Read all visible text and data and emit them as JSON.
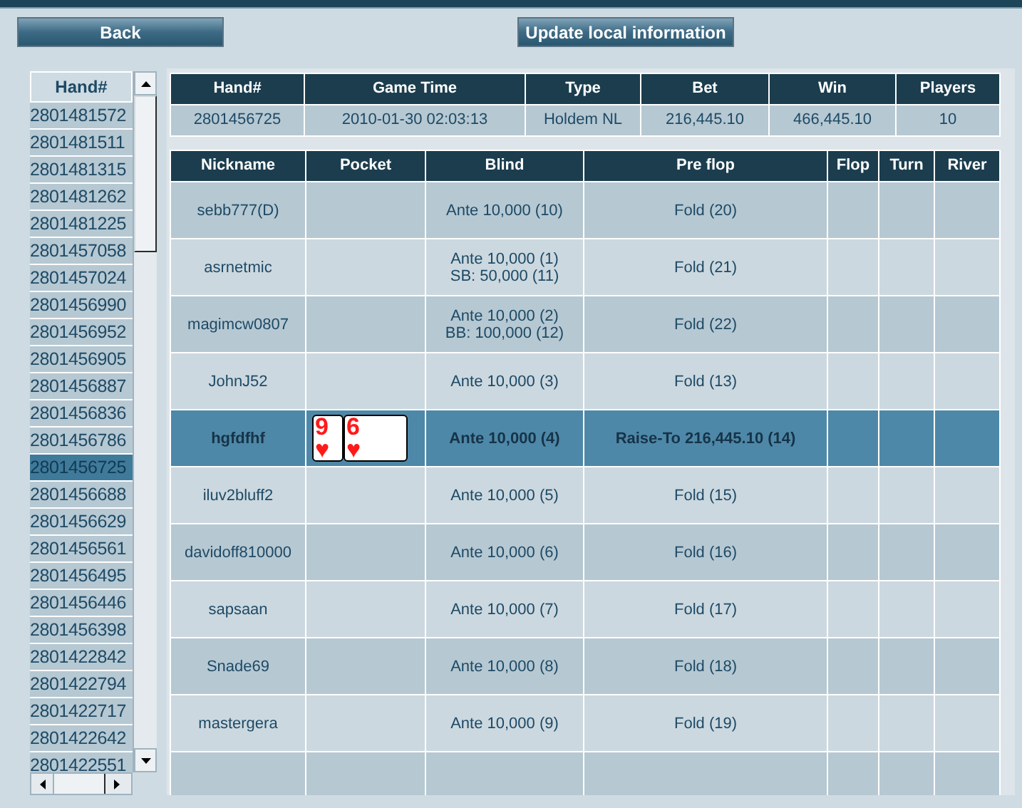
{
  "toolbar": {
    "back": "Back",
    "update": "Update local information"
  },
  "hand_list": {
    "header": "Hand#",
    "items": [
      {
        "label": "2801481572",
        "selected": false
      },
      {
        "label": "2801481511",
        "selected": false
      },
      {
        "label": "2801481315",
        "selected": false
      },
      {
        "label": "2801481262",
        "selected": false
      },
      {
        "label": "2801481225",
        "selected": false
      },
      {
        "label": "2801457058",
        "selected": false
      },
      {
        "label": "2801457024",
        "selected": false
      },
      {
        "label": "2801456990",
        "selected": false
      },
      {
        "label": "2801456952",
        "selected": false
      },
      {
        "label": "2801456905",
        "selected": false
      },
      {
        "label": "2801456887",
        "selected": false
      },
      {
        "label": "2801456836",
        "selected": false
      },
      {
        "label": "2801456786",
        "selected": false
      },
      {
        "label": "2801456725",
        "selected": true
      },
      {
        "label": "2801456688",
        "selected": false
      },
      {
        "label": "2801456629",
        "selected": false
      },
      {
        "label": "2801456561",
        "selected": false
      },
      {
        "label": "2801456495",
        "selected": false
      },
      {
        "label": "2801456446",
        "selected": false
      },
      {
        "label": "2801456398",
        "selected": false
      },
      {
        "label": "2801422842",
        "selected": false
      },
      {
        "label": "2801422794",
        "selected": false
      },
      {
        "label": "2801422717",
        "selected": false
      },
      {
        "label": "2801422642",
        "selected": false
      },
      {
        "label": "2801422551",
        "selected": false
      }
    ]
  },
  "hand_info": {
    "columns": [
      "Hand#",
      "Game Time",
      "Type",
      "Bet",
      "Win",
      "Players"
    ],
    "row": [
      "2801456725",
      "2010-01-30 02:03:13",
      "Holdem NL",
      "216,445.10",
      "466,445.10",
      "10"
    ]
  },
  "players": {
    "columns": [
      "Nickname",
      "Pocket",
      "Blind",
      "Pre flop",
      "Flop",
      "Turn",
      "River"
    ],
    "rows": [
      {
        "nickname": "sebb777(D)",
        "blind": [
          "Ante 10,000 (10)"
        ],
        "pre_flop": "Fold (20)",
        "selected": false
      },
      {
        "nickname": "asrnetmic",
        "blind": [
          "Ante 10,000 (1)",
          "SB: 50,000 (11)"
        ],
        "pre_flop": "Fold (21)",
        "selected": false
      },
      {
        "nickname": "magimcw0807",
        "blind": [
          "Ante 10,000 (2)",
          "BB: 100,000 (12)"
        ],
        "pre_flop": "Fold (22)",
        "selected": false
      },
      {
        "nickname": "JohnJ52",
        "blind": [
          "Ante 10,000 (3)"
        ],
        "pre_flop": "Fold (13)",
        "selected": false
      },
      {
        "nickname": "hgfdfhf",
        "pocket": [
          {
            "rank": "9",
            "suit": "♥"
          },
          {
            "rank": "6",
            "suit": "♥"
          }
        ],
        "blind": [
          "Ante 10,000 (4)"
        ],
        "pre_flop": "Raise-To 216,445.10 (14)",
        "selected": true
      },
      {
        "nickname": "iluv2bluff2",
        "blind": [
          "Ante 10,000 (5)"
        ],
        "pre_flop": "Fold (15)",
        "selected": false
      },
      {
        "nickname": "davidoff810000",
        "blind": [
          "Ante 10,000 (6)"
        ],
        "pre_flop": "Fold (16)",
        "selected": false
      },
      {
        "nickname": "sapsaan",
        "blind": [
          "Ante 10,000 (7)"
        ],
        "pre_flop": "Fold (17)",
        "selected": false
      },
      {
        "nickname": "Snade69",
        "blind": [
          "Ante 10,000 (8)"
        ],
        "pre_flop": "Fold (18)",
        "selected": false
      },
      {
        "nickname": "mastergera",
        "blind": [
          "Ante 10,000 (9)"
        ],
        "pre_flop": "Fold (19)",
        "selected": false
      }
    ]
  }
}
